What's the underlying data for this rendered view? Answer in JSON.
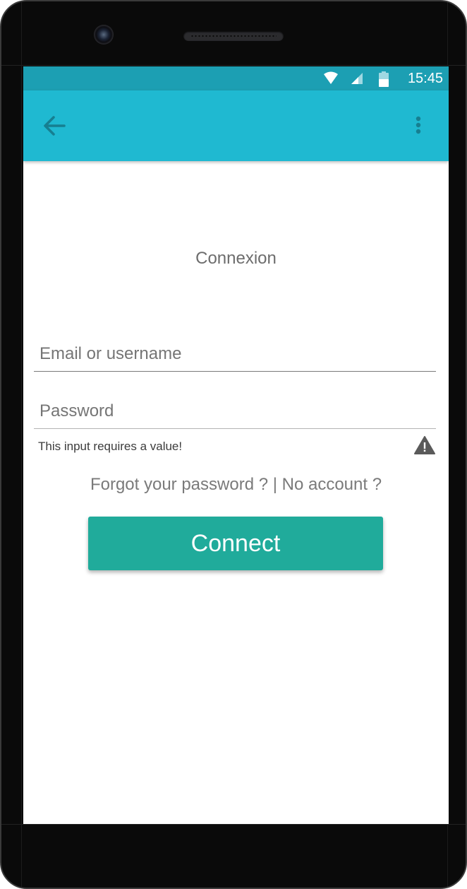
{
  "status_bar": {
    "time": "15:45",
    "icons": [
      "wifi-icon",
      "signal-icon",
      "battery-icon"
    ],
    "background": "#1c9fb3"
  },
  "app_bar": {
    "background": "#1fb9d1",
    "back_icon": "arrow-left-icon",
    "menu_icon": "more-vertical-icon"
  },
  "login": {
    "title": "Connexion",
    "email_placeholder": "Email or username",
    "password_placeholder": "Password",
    "error_message": "This input requires a value!",
    "error_icon": "warning-icon",
    "forgot_link": "Forgot your password ?",
    "separator": " | ",
    "no_account_link": "No account ?",
    "connect_label": "Connect"
  },
  "colors": {
    "accent": "#20ab9b",
    "primary": "#1fb9d1",
    "primary_dark": "#1c9fb3"
  }
}
